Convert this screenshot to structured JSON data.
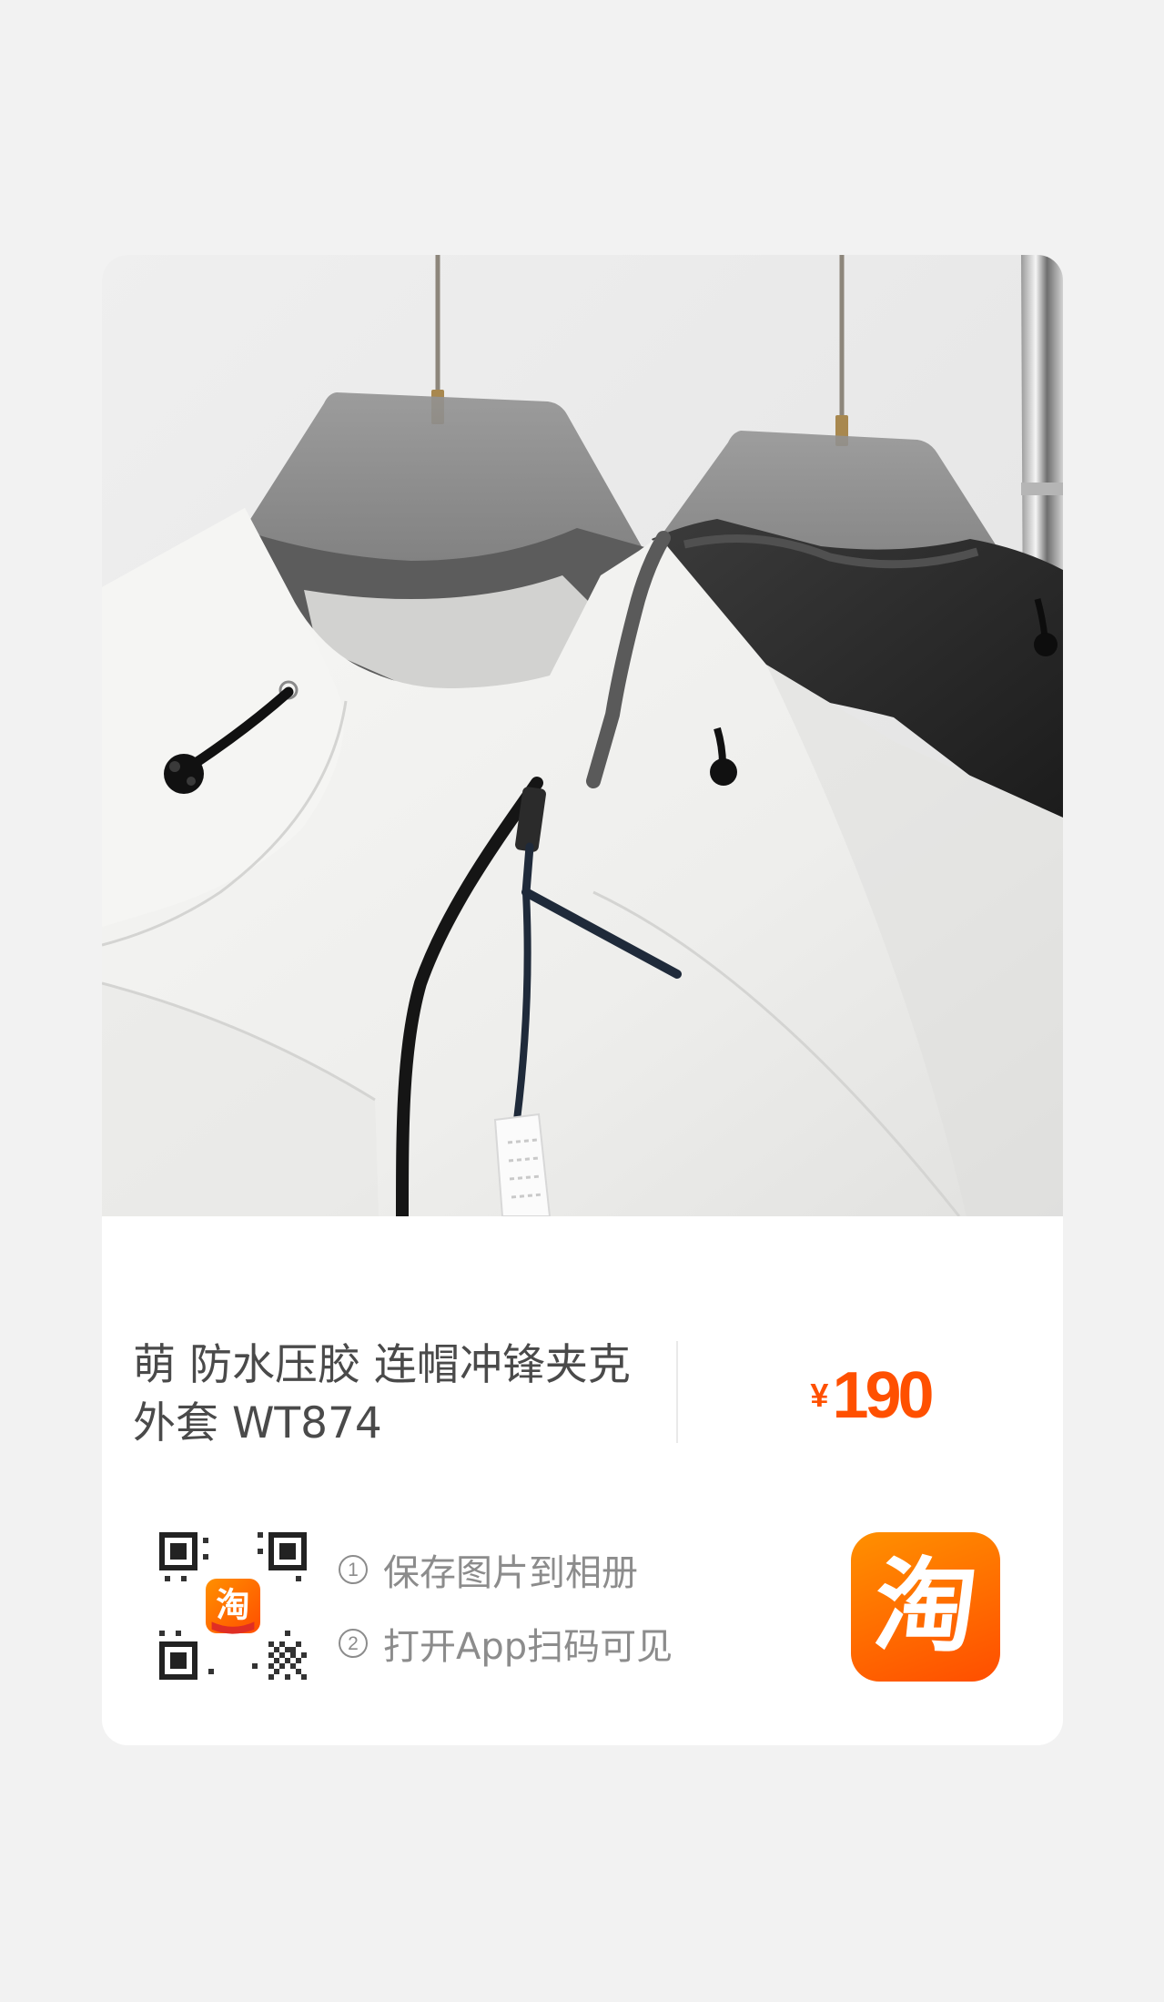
{
  "product": {
    "title": "萌 防水压胶 连帽冲锋夹克外套 WT874",
    "price": {
      "currency": "¥",
      "amount": "190"
    }
  },
  "share": {
    "qr_code": {
      "icon": "qr-code",
      "center_logo_text": "淘"
    },
    "steps": [
      {
        "number": "1",
        "text": "保存图片到相册"
      },
      {
        "number": "2",
        "text": "打开App扫码可见"
      }
    ],
    "app_logo": {
      "icon": "taobao-logo",
      "text": "淘"
    }
  },
  "colors": {
    "background": "#f2f2f2",
    "card": "#ffffff",
    "accent": "#ff5000",
    "logo_gradient_start": "#ff9000",
    "logo_gradient_end": "#ff4e00",
    "title_text": "#4a4a4a",
    "step_text": "#8c8c8c",
    "divider": "#e9e9e9"
  }
}
